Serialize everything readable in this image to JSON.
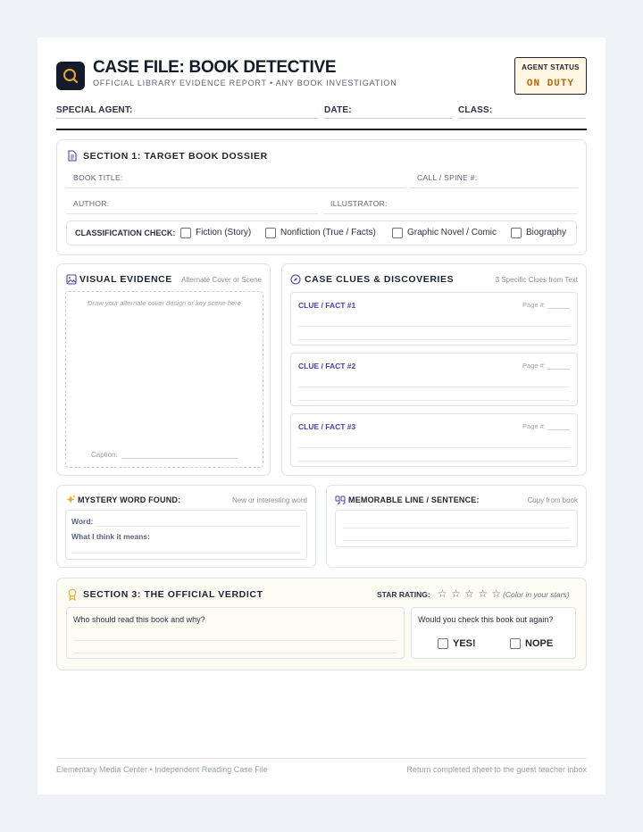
{
  "header": {
    "title": "CASE FILE: BOOK DETECTIVE",
    "subtitle": "OFFICIAL LIBRARY EVIDENCE REPORT • ANY BOOK INVESTIGATION",
    "status_label": "AGENT STATUS",
    "status_value": "ON DUTY"
  },
  "fields": {
    "agent": "SPECIAL AGENT:",
    "date": "DATE:",
    "class": "CLASS:"
  },
  "section1": {
    "title": "SECTION 1: TARGET BOOK DOSSIER",
    "book_title": "BOOK TITLE:",
    "call": "CALL / SPINE #:",
    "author": "AUTHOR:",
    "illustrator": "ILLUSTRATOR:",
    "classification_label": "CLASSIFICATION CHECK:",
    "options": [
      "Fiction (Story)",
      "Nonfiction (True / Facts)",
      "Graphic Novel / Comic",
      "Biography"
    ]
  },
  "visual": {
    "title": "VISUAL EVIDENCE",
    "sub": "Alternate Cover or Scene",
    "hint": "Draw your alternate cover design or key scene here",
    "caption": "Caption:"
  },
  "clues": {
    "title": "CASE CLUES & DISCOVERIES",
    "sub": "3 Specific Clues from Text",
    "items": [
      {
        "title": "CLUE / FACT #1",
        "page": "Page #: ______"
      },
      {
        "title": "CLUE / FACT #2",
        "page": "Page #: ______"
      },
      {
        "title": "CLUE / FACT #3",
        "page": "Page #: ______"
      }
    ]
  },
  "mystery": {
    "title": "MYSTERY WORD FOUND:",
    "sub": "New or interesting word",
    "word": "Word:",
    "means": "What I think it means:"
  },
  "memorable": {
    "title": "MEMORABLE LINE / SENTENCE:",
    "sub": "Copy from book"
  },
  "verdict": {
    "title": "SECTION 3: THE OFFICIAL VERDICT",
    "rating_label": "STAR RATING:",
    "stars": "☆ ☆ ☆ ☆ ☆",
    "rating_hint": "(Color in your stars)",
    "who": "Who should read this book and why?",
    "again": "Would you check this book out again?",
    "yes": "YES!",
    "nope": "NOPE"
  },
  "footer": {
    "left": "Elementary Media Center • Independent Reading Case File",
    "right": "Return completed sheet to the guest teacher inbox"
  },
  "colors": {
    "accent_gold": "#e9a92c",
    "accent_purple": "#4a3fb0",
    "status_orange": "#b8670a",
    "ink": "#161b2b"
  },
  "icons": [
    "magnifier-icon",
    "document-icon",
    "image-icon",
    "compass-icon",
    "sparkle-icon",
    "quote-icon",
    "award-icon",
    "star-icon"
  ]
}
